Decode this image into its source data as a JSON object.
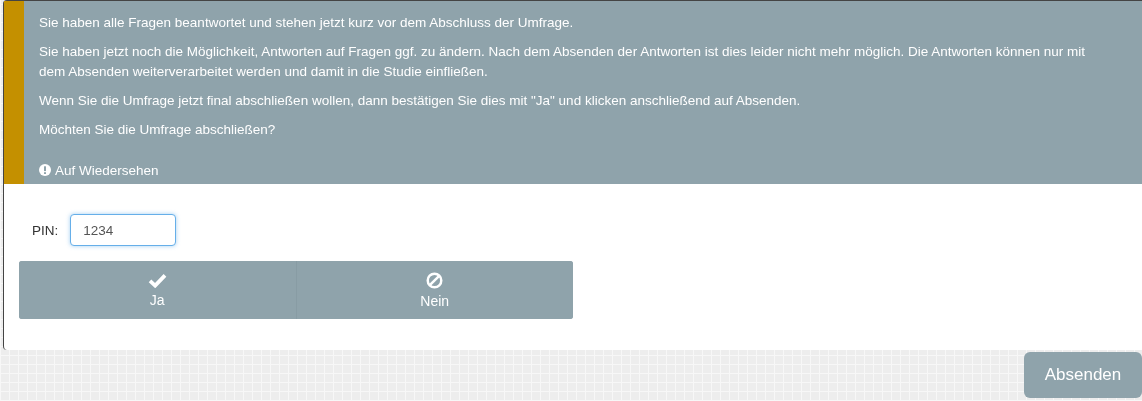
{
  "notice": {
    "paragraphs": [
      "Sie haben alle Fragen beantwortet und stehen jetzt kurz vor dem Abschluss der Umfrage.",
      "Sie haben jetzt noch die Möglichkeit, Antworten auf Fragen ggf. zu ändern. Nach dem Absenden der Antworten ist dies leider nicht mehr möglich. Die Antworten können nur mit dem Absenden weiterverarbeitet werden und damit in die Studie einfließen.",
      "Wenn Sie die Umfrage jetzt final abschließen wollen, dann bestätigen Sie dies mit \"Ja\" und klicken anschließend auf Absenden.",
      "Möchten Sie die Umfrage abschließen?"
    ],
    "footer": "Auf Wiedersehen"
  },
  "pin": {
    "label": "PIN:",
    "value": "1234"
  },
  "choices": [
    {
      "label": "Ja",
      "kind": "check",
      "selected": false
    },
    {
      "label": "Nein",
      "kind": "ban",
      "selected": false
    }
  ],
  "submit_button": "Absenden"
}
